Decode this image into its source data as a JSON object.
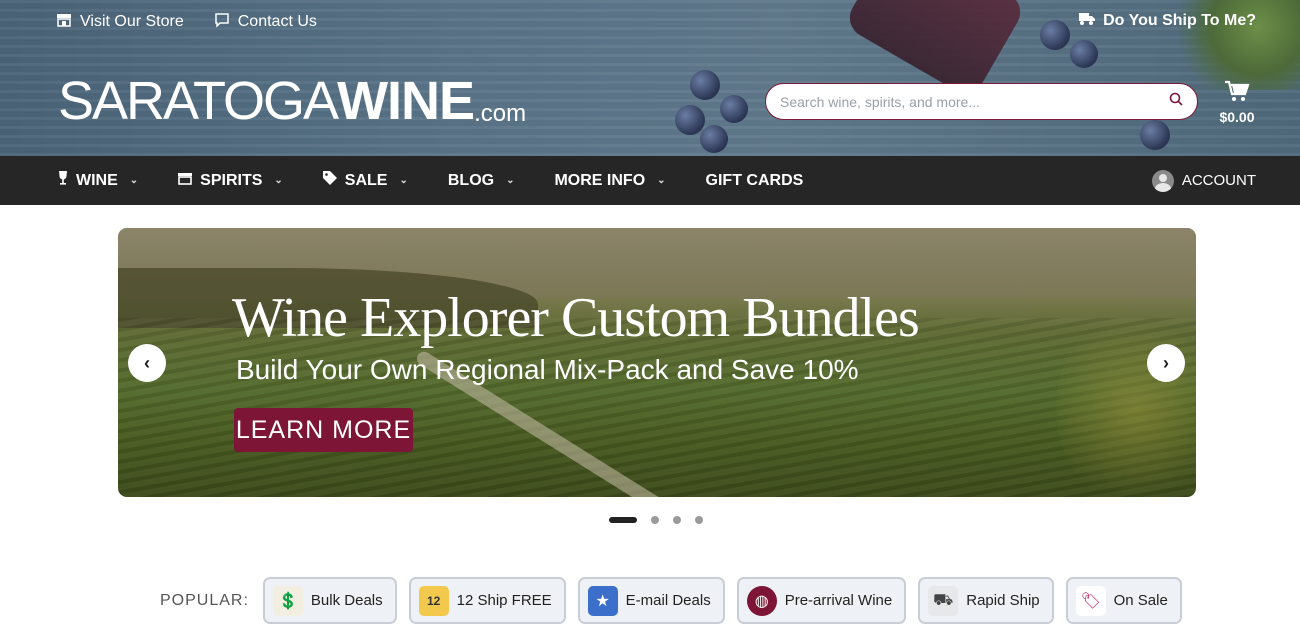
{
  "topbar": {
    "visit_store": "Visit Our Store",
    "contact_us": "Contact Us",
    "ship_question": "Do You Ship To Me?"
  },
  "logo": {
    "part1": "SARATOGA",
    "part2": "WINE",
    "part3": ".com"
  },
  "search": {
    "placeholder": "Search wine, spirits, and more..."
  },
  "cart": {
    "amount": "$0.00"
  },
  "nav": {
    "items": [
      {
        "label": "WINE",
        "icon": "wine-glass-icon",
        "dropdown": true
      },
      {
        "label": "SPIRITS",
        "icon": "liquor-icon",
        "dropdown": true
      },
      {
        "label": "SALE",
        "icon": "tag-icon",
        "dropdown": true
      },
      {
        "label": "BLOG",
        "dropdown": true
      },
      {
        "label": "MORE INFO",
        "dropdown": true
      },
      {
        "label": "GIFT CARDS",
        "dropdown": false
      }
    ],
    "account": "ACCOUNT"
  },
  "hero": {
    "title": "Wine Explorer Custom Bundles",
    "subtitle": "Build Your Own Regional Mix-Pack and Save 10%",
    "button": "LEARN MORE",
    "slides": 4,
    "active_slide": 1
  },
  "popular": {
    "label": "POPULAR:",
    "items": [
      {
        "label": "Bulk Deals",
        "icon": "money-box-icon"
      },
      {
        "label": "12 Ship FREE",
        "icon": "calendar-12-icon"
      },
      {
        "label": "E-mail Deals",
        "icon": "star-icon"
      },
      {
        "label": "Pre-arrival Wine",
        "icon": "globe-icon"
      },
      {
        "label": "Rapid Ship",
        "icon": "truck-icon"
      },
      {
        "label": "On Sale",
        "icon": "sale-tag-icon"
      }
    ]
  },
  "colors": {
    "accent": "#7c1536",
    "nav_bg": "#262626",
    "header_bg": "#5a7488"
  }
}
